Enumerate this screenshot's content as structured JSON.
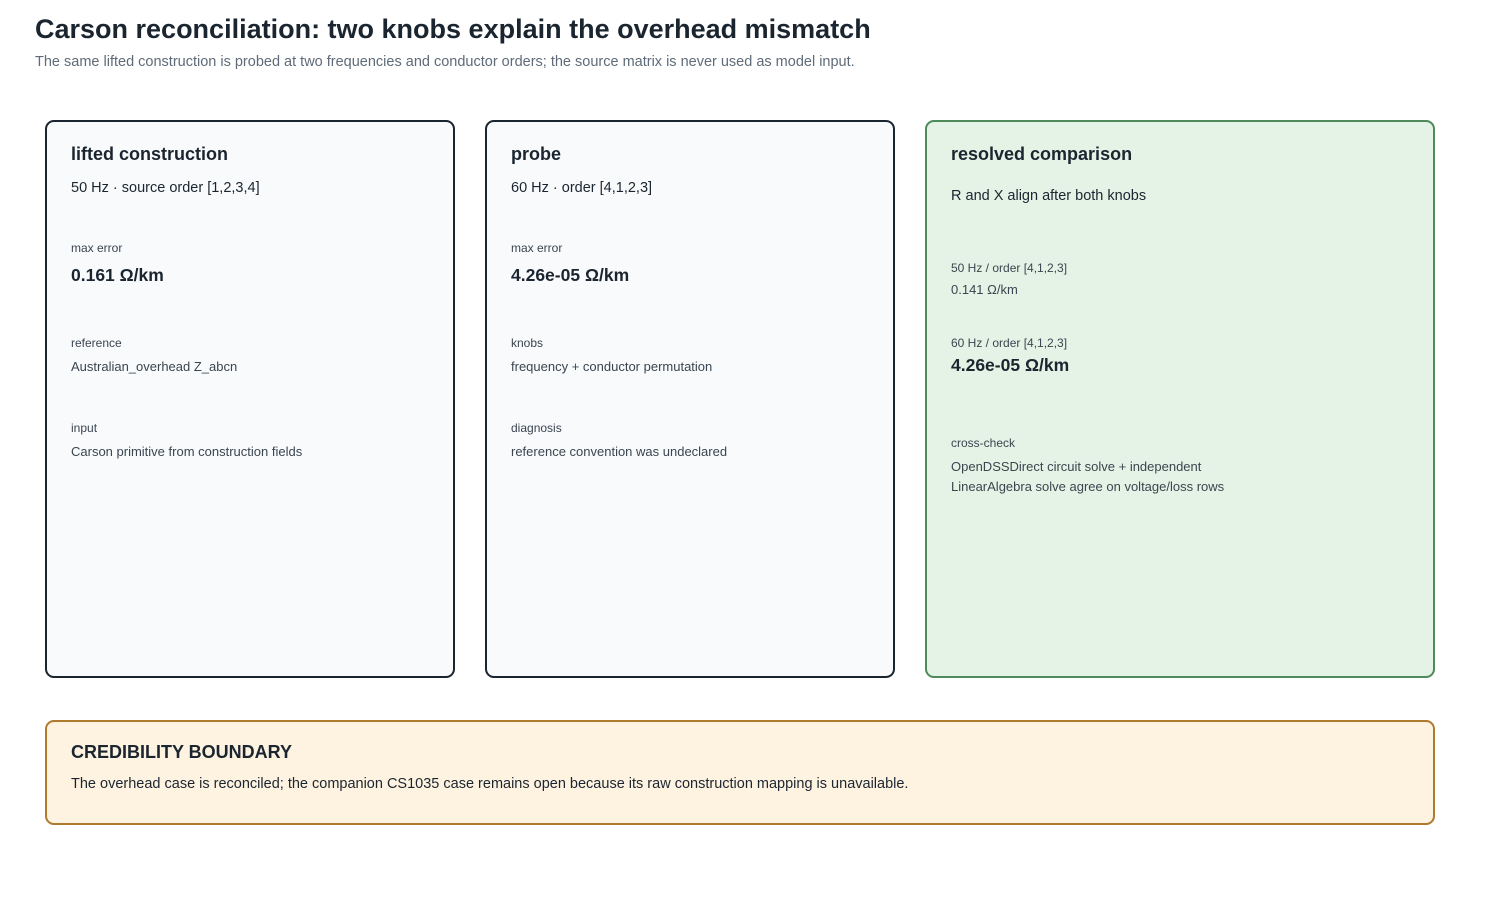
{
  "header": {
    "title": "Carson reconciliation: two knobs explain the overhead mismatch",
    "subtitle": "The same lifted construction is probed at two frequencies and conductor orders; the source matrix is never used as model input."
  },
  "cards": {
    "lifted": {
      "title": "lifted construction",
      "subtitle": "50 Hz · source order [1,2,3,4]",
      "max_error_label": "max error",
      "max_error_value": "0.161 Ω/km",
      "reference_label": "reference",
      "reference_value": "Australian_overhead Z_abcn",
      "input_label": "input",
      "input_value": "Carson primitive from construction fields"
    },
    "probe": {
      "title": "probe",
      "subtitle": "60 Hz · order [4,1,2,3]",
      "max_error_label": "max error",
      "max_error_value": "4.26e-05 Ω/km",
      "knobs_label": "knobs",
      "knobs_value": "frequency + conductor permutation",
      "diagnosis_label": "diagnosis",
      "diagnosis_value": "reference convention was undeclared"
    },
    "resolved": {
      "title": "resolved comparison",
      "subtitle": "R and X align after both knobs",
      "row1_label": "50 Hz / order [4,1,2,3]",
      "row1_value": "0.141 Ω/km",
      "row2_label": "60 Hz / order [4,1,2,3]",
      "row2_value": "4.26e-05 Ω/km",
      "crosscheck_label": "cross-check",
      "crosscheck_value": "OpenDSSDirect circuit solve + independent LinearAlgebra solve agree on voltage/loss rows"
    }
  },
  "boundary": {
    "title": "CREDIBILITY BOUNDARY",
    "text": "The overhead case is reconciled; the companion CS1035 case remains open because its raw construction mapping is unavailable."
  },
  "colors": {
    "neutral_card_bg": "#f8fafc",
    "neutral_card_border": "#1b2530",
    "resolved_card_bg": "#e4f3e5",
    "resolved_card_border": "#4e8a5a",
    "boundary_bg": "#fef3e0",
    "boundary_border": "#b07a2e"
  }
}
